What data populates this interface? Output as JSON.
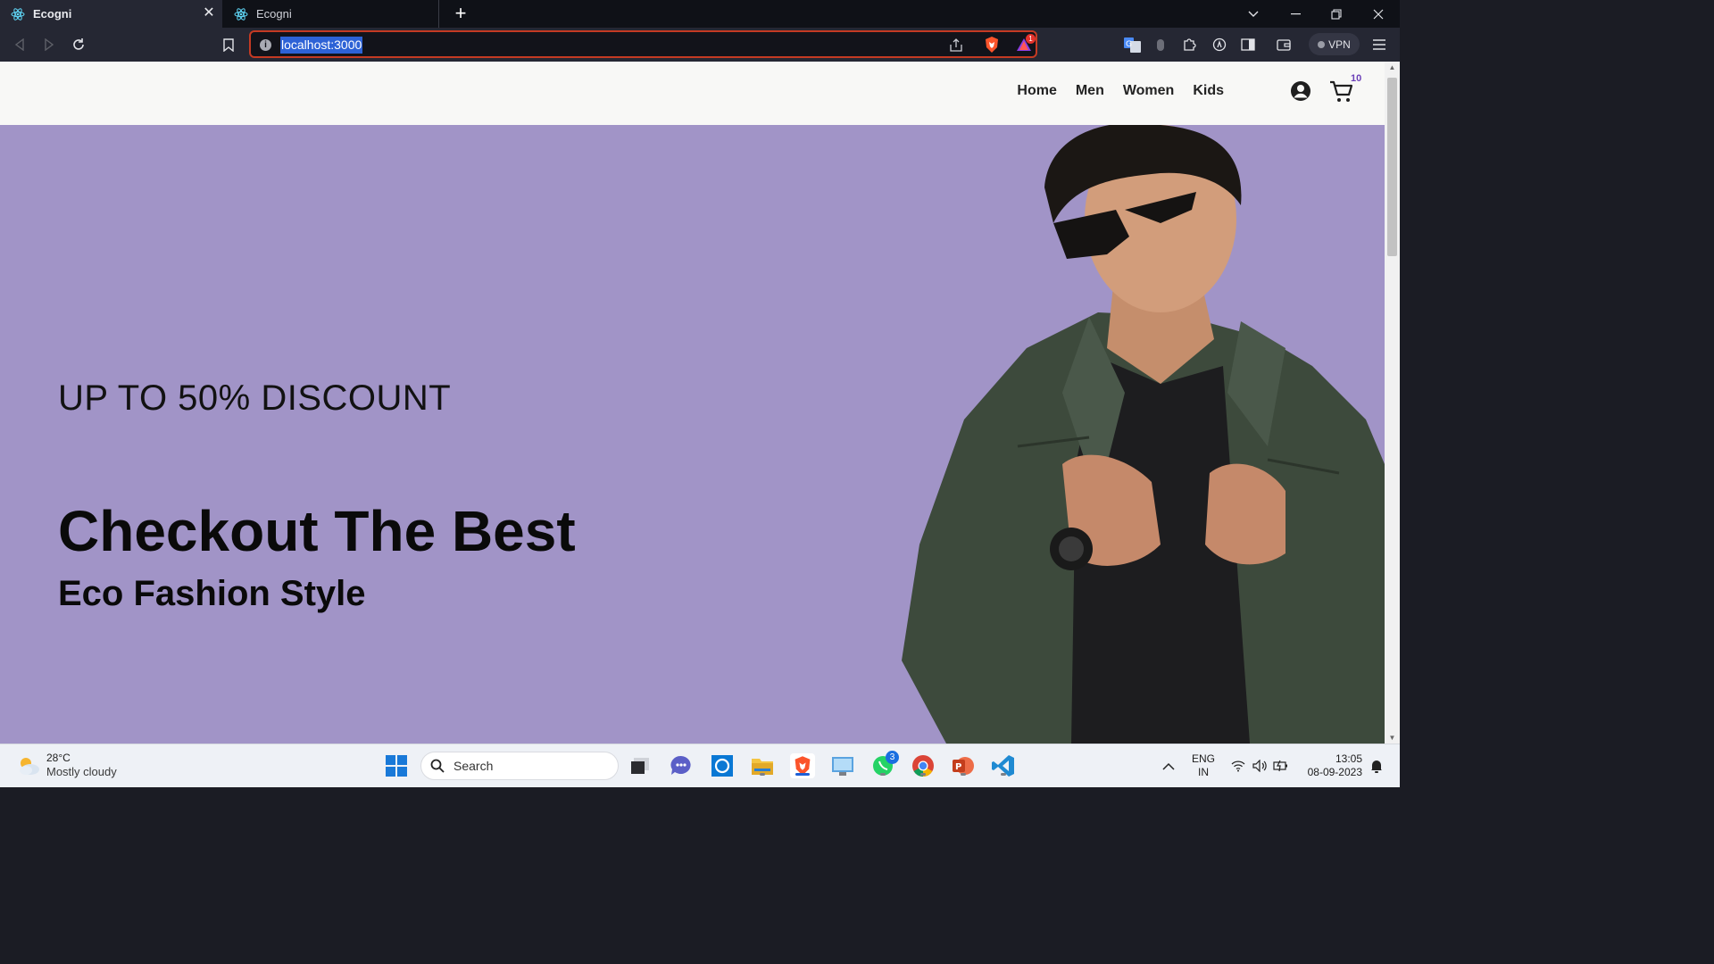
{
  "browser": {
    "tabs": [
      {
        "title": "Ecogni",
        "active": true
      },
      {
        "title": "Ecogni",
        "active": false
      }
    ],
    "url": "localhost:3000",
    "vpn_label": "VPN",
    "brave_alert_count": "1"
  },
  "site": {
    "nav": {
      "links": [
        "Home",
        "Men",
        "Women",
        "Kids"
      ],
      "cart_count": "10"
    },
    "hero": {
      "discount": "UP TO 50% DISCOUNT",
      "headline": "Checkout The Best",
      "subline": "Eco Fashion Style",
      "background_color": "#a194c7"
    }
  },
  "taskbar": {
    "weather": {
      "temp": "28°C",
      "condition": "Mostly cloudy"
    },
    "search_placeholder": "Search",
    "whatsapp_badge": "3",
    "language": {
      "line1": "ENG",
      "line2": "IN"
    },
    "clock": {
      "time": "13:05",
      "date": "08-09-2023"
    }
  }
}
